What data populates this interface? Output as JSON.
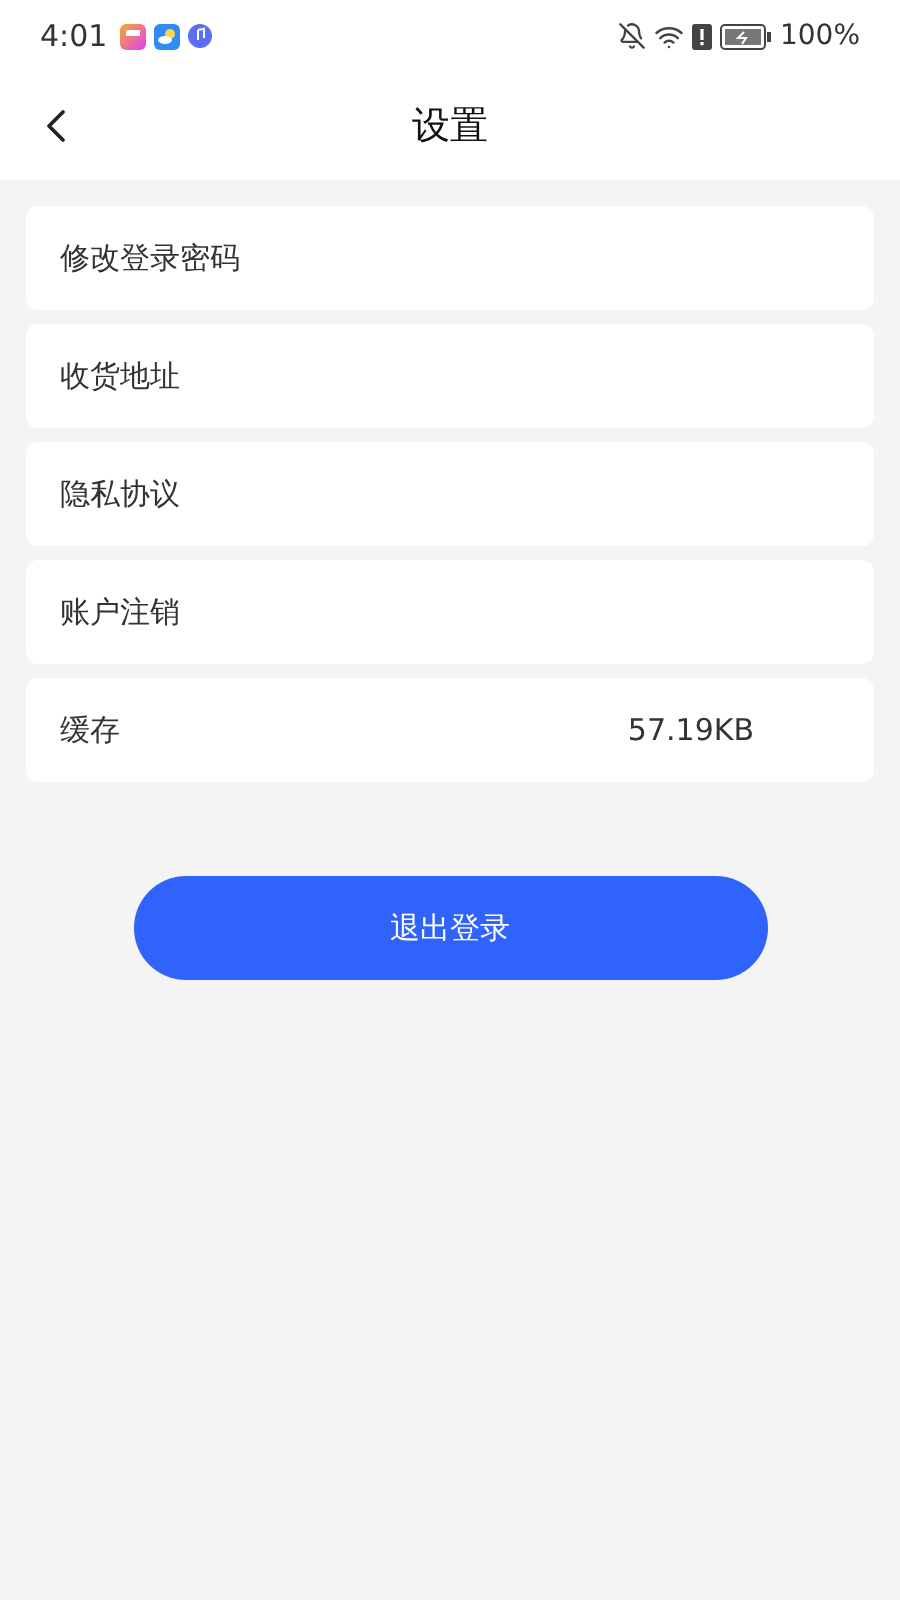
{
  "status_bar": {
    "time": "4:01",
    "battery": "100%"
  },
  "header": {
    "title": "设置"
  },
  "items": [
    {
      "label": "修改登录密码"
    },
    {
      "label": "收货地址"
    },
    {
      "label": "隐私协议"
    },
    {
      "label": "账户注销"
    },
    {
      "label": "缓存",
      "value": "57.19KB"
    }
  ],
  "logout_button": "退出登录"
}
